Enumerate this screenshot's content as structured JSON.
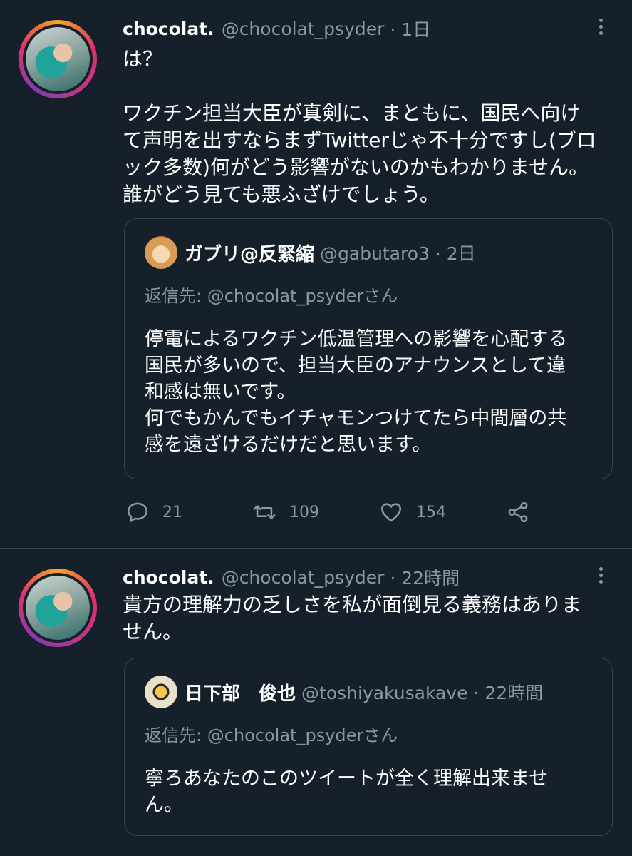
{
  "tweets": [
    {
      "author": {
        "name": "chocolat.",
        "handle": "@chocolat_psyder",
        "time": "· 1日"
      },
      "lines": [
        "は？",
        "",
        "ワクチン担当大臣が真剣に、まともに、国民へ向け",
        "て声明を出すならまずTwitterじゃ不十分ですし(ブロ",
        "ック多数)何がどう影響がないのかもわかりません。",
        "誰がどう見ても悪ふざけでしょう。"
      ],
      "quote": {
        "name": "ガブリ@反緊縮",
        "handle": "@gabutaro3 · 2日",
        "reply_to": "返信先: @chocolat_psyderさん",
        "lines": [
          "停電によるワクチン低温管理への影響を心配する",
          "国民が多いので、担当大臣のアナウンスとして違",
          "和感は無いです。",
          "何でもかんでもイチャモンつけてたら中間層の共",
          "感を遠ざけるだけだと思います。"
        ]
      },
      "stats": {
        "replies": "21",
        "retweets": "109",
        "likes": "154"
      }
    },
    {
      "author": {
        "name": "chocolat.",
        "handle": "@chocolat_psyder",
        "time": "· 22時間"
      },
      "lines": [
        "貴方の理解力の乏しさを私が面倒見る義務はありま",
        "せん。"
      ],
      "quote": {
        "name": "日下部　俊也",
        "handle": "@toshiyakusakave · 22時間",
        "reply_to": "返信先: @chocolat_psyderさん",
        "lines": [
          "寧ろあなたのこのツイートが全く理解出来ませ",
          "ん。"
        ]
      }
    }
  ],
  "colors": {
    "background": "#15202b",
    "secondary_text": "#8899a6",
    "border": "#38444d"
  }
}
